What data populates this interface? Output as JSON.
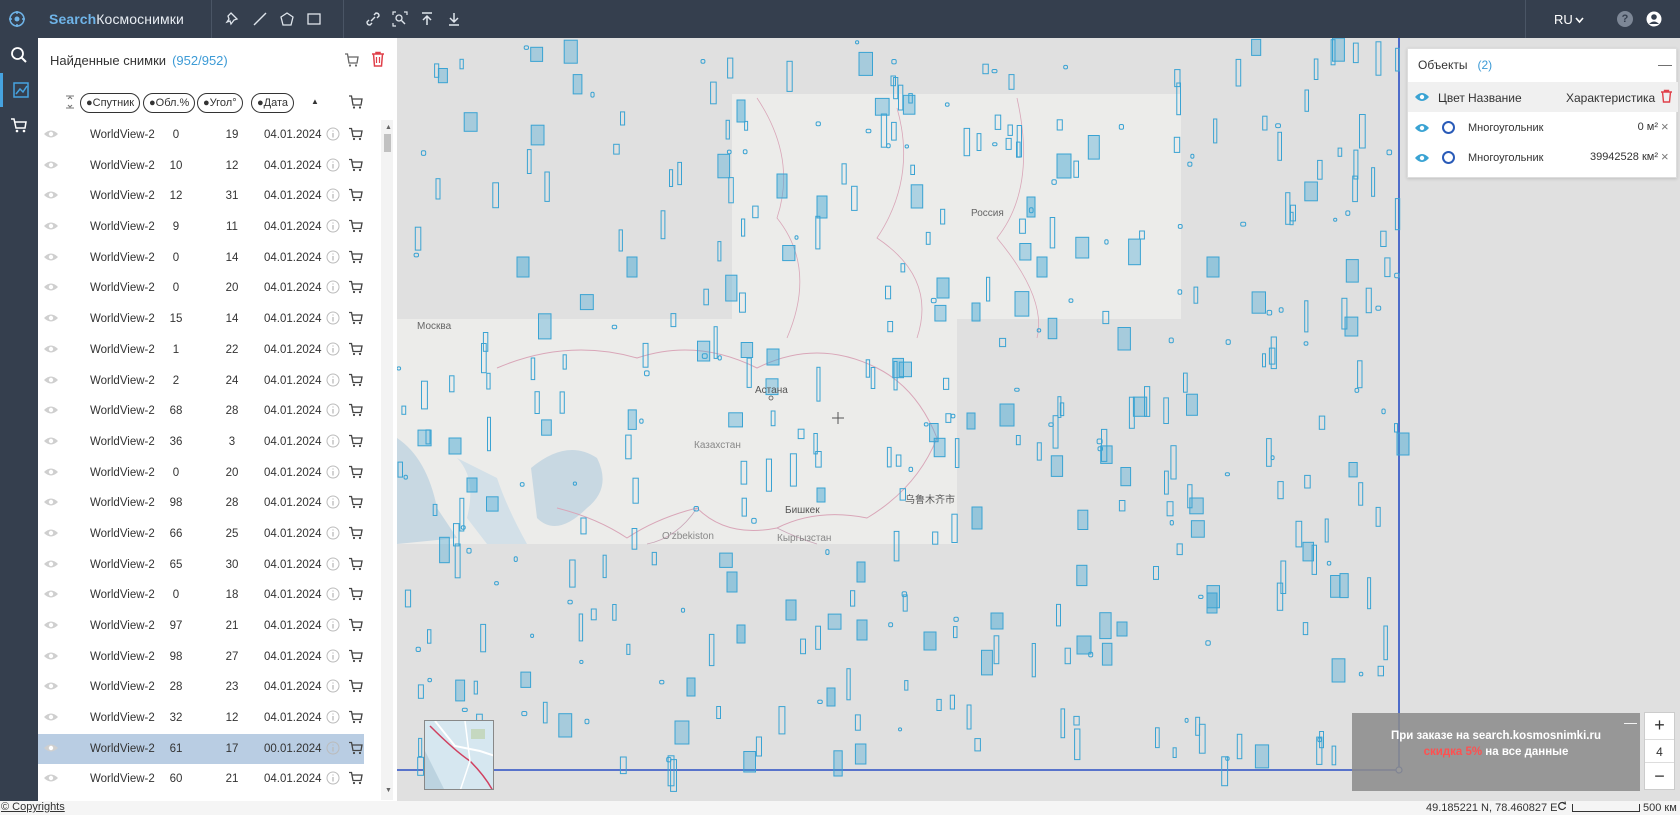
{
  "app": {
    "brand_part1": "Search",
    "brand_part2": "Космоснимки",
    "language": "RU",
    "help_label": "?"
  },
  "results": {
    "title": "Найденные снимки",
    "count": "(952/952)",
    "columns": {
      "satellite": "●Спутник",
      "cloud": "●Обл.%",
      "angle": "●Угол°",
      "date": "●Дата",
      "sort_indicator": "▲"
    },
    "rows": [
      {
        "sat": "WorldView-2",
        "cloud": "0",
        "angle": "19",
        "date": "04.01.2024",
        "selected": false
      },
      {
        "sat": "WorldView-2",
        "cloud": "10",
        "angle": "12",
        "date": "04.01.2024",
        "selected": false
      },
      {
        "sat": "WorldView-2",
        "cloud": "12",
        "angle": "31",
        "date": "04.01.2024",
        "selected": false
      },
      {
        "sat": "WorldView-2",
        "cloud": "9",
        "angle": "11",
        "date": "04.01.2024",
        "selected": false
      },
      {
        "sat": "WorldView-2",
        "cloud": "0",
        "angle": "14",
        "date": "04.01.2024",
        "selected": false
      },
      {
        "sat": "WorldView-2",
        "cloud": "0",
        "angle": "20",
        "date": "04.01.2024",
        "selected": false
      },
      {
        "sat": "WorldView-2",
        "cloud": "15",
        "angle": "14",
        "date": "04.01.2024",
        "selected": false
      },
      {
        "sat": "WorldView-2",
        "cloud": "1",
        "angle": "22",
        "date": "04.01.2024",
        "selected": false
      },
      {
        "sat": "WorldView-2",
        "cloud": "2",
        "angle": "24",
        "date": "04.01.2024",
        "selected": false
      },
      {
        "sat": "WorldView-2",
        "cloud": "68",
        "angle": "28",
        "date": "04.01.2024",
        "selected": false
      },
      {
        "sat": "WorldView-2",
        "cloud": "36",
        "angle": "3",
        "date": "04.01.2024",
        "selected": false
      },
      {
        "sat": "WorldView-2",
        "cloud": "0",
        "angle": "20",
        "date": "04.01.2024",
        "selected": false
      },
      {
        "sat": "WorldView-2",
        "cloud": "98",
        "angle": "28",
        "date": "04.01.2024",
        "selected": false
      },
      {
        "sat": "WorldView-2",
        "cloud": "66",
        "angle": "25",
        "date": "04.01.2024",
        "selected": false
      },
      {
        "sat": "WorldView-2",
        "cloud": "65",
        "angle": "30",
        "date": "04.01.2024",
        "selected": false
      },
      {
        "sat": "WorldView-2",
        "cloud": "0",
        "angle": "18",
        "date": "04.01.2024",
        "selected": false
      },
      {
        "sat": "WorldView-2",
        "cloud": "97",
        "angle": "21",
        "date": "04.01.2024",
        "selected": false
      },
      {
        "sat": "WorldView-2",
        "cloud": "98",
        "angle": "27",
        "date": "04.01.2024",
        "selected": false
      },
      {
        "sat": "WorldView-2",
        "cloud": "28",
        "angle": "23",
        "date": "04.01.2024",
        "selected": false
      },
      {
        "sat": "WorldView-2",
        "cloud": "32",
        "angle": "12",
        "date": "04.01.2024",
        "selected": false
      },
      {
        "sat": "WorldView-2",
        "cloud": "61",
        "angle": "17",
        "date": "00.01.2024",
        "selected": true
      },
      {
        "sat": "WorldView-2",
        "cloud": "60",
        "angle": "21",
        "date": "04.01.2024",
        "selected": false
      }
    ]
  },
  "map": {
    "labels": {
      "russia": "Россия",
      "astana": "Астана",
      "kazakhstan": "Казахстан",
      "bishkek": "Бишкек",
      "urumqi": "乌鲁木齐市",
      "uzbekistan": "O'zbekiston",
      "kyrgyzstan": "Кыргызстан",
      "moscow": "Москва"
    }
  },
  "objects": {
    "title": "Объекты",
    "count": "(2)",
    "collapse": "—",
    "header": {
      "color": "Цвет",
      "name": "Название",
      "characteristic": "Характеристика"
    },
    "rows": [
      {
        "name": "Многоугольник",
        "value": "0 м²"
      },
      {
        "name": "Многоугольник",
        "value": "39942528 км²"
      }
    ]
  },
  "promo": {
    "close": "—",
    "line1": "При заказе на search.kosmosnimki.ru",
    "discount": "скидка 5%",
    "line2_rest": " на все данные"
  },
  "zoom": {
    "plus": "+",
    "level": "4",
    "minus": "−"
  },
  "footer": {
    "copyrights": "© Copyrights",
    "coords": "49.185221 N, 78.460827 E",
    "scale": "500 км"
  },
  "colors": {
    "topbar": "#353f4e",
    "accent": "#3d9bd6",
    "footprint": "#3aa3d3",
    "aoi": "#2a4fc4",
    "selected_row": "#b9cde3",
    "discount": "#ff5050"
  }
}
